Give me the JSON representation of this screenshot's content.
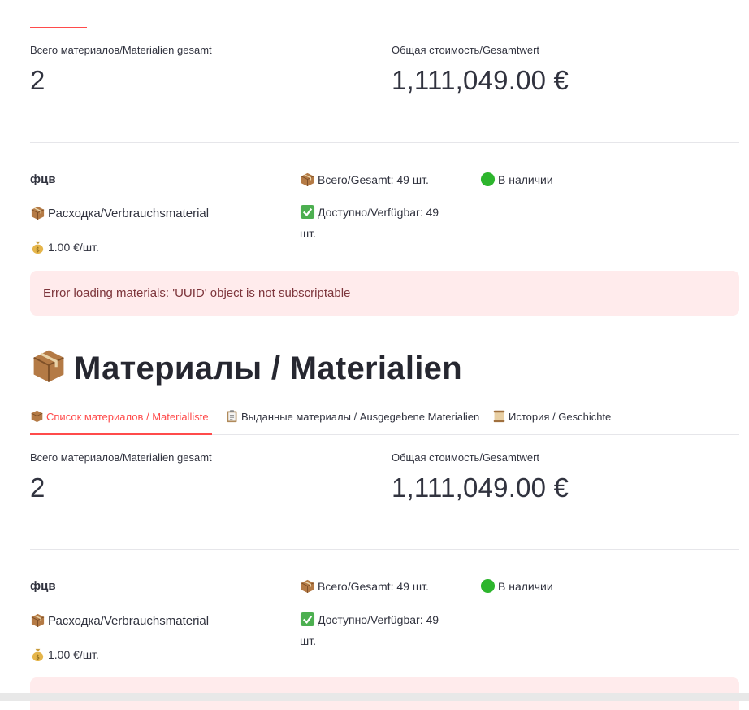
{
  "colors": {
    "accent": "#ff4b4b",
    "error_bg": "#ffebec",
    "error_text": "#7d353b",
    "divider": "#e6e6ea"
  },
  "top_section": {
    "metric_total_label": "Всего материалов/Materialien gesamt",
    "metric_total_value": "2",
    "metric_cost_label": "Общая стоимость/Gesamtwert",
    "metric_cost_value": "1,111,049.00 €",
    "material": {
      "name": "фцв",
      "category": "Расходка/Verbrauchsmaterial",
      "category_icon": "package-icon",
      "price": "1.00 €/шт.",
      "price_icon": "money-bag-icon",
      "total": "Всего/Gesamt: 49 шт.",
      "total_icon": "package-icon",
      "available_line1": "Доступно/Verfügbar: 49",
      "available_line2": "шт.",
      "available_icon": "check-mark-icon",
      "status": "В наличии",
      "status_icon": "green-circle-icon"
    },
    "error_message": "Error loading materials: 'UUID' object is not subscriptable"
  },
  "heading": {
    "title": "Материалы / Materialien",
    "icon": "package-icon"
  },
  "tabs": [
    {
      "label": "Список материалов / Materialliste",
      "icon": "package-icon",
      "active": true
    },
    {
      "label": "Выданные материалы / Ausgegebene Materialien",
      "icon": "clipboard-icon",
      "active": false
    },
    {
      "label": "История / Geschichte",
      "icon": "scroll-icon",
      "active": false
    }
  ],
  "bottom_section": {
    "metric_total_label": "Всего материалов/Materialien gesamt",
    "metric_total_value": "2",
    "metric_cost_label": "Общая стоимость/Gesamtwert",
    "metric_cost_value": "1,111,049.00 €",
    "material": {
      "name": "фцв",
      "category": "Расходка/Verbrauchsmaterial",
      "price": "1.00 €/шт.",
      "total": "Всего/Gesamt: 49 шт.",
      "available_line1": "Доступно/Verfügbar: 49",
      "available_line2": "шт.",
      "status": "В наличии"
    }
  }
}
